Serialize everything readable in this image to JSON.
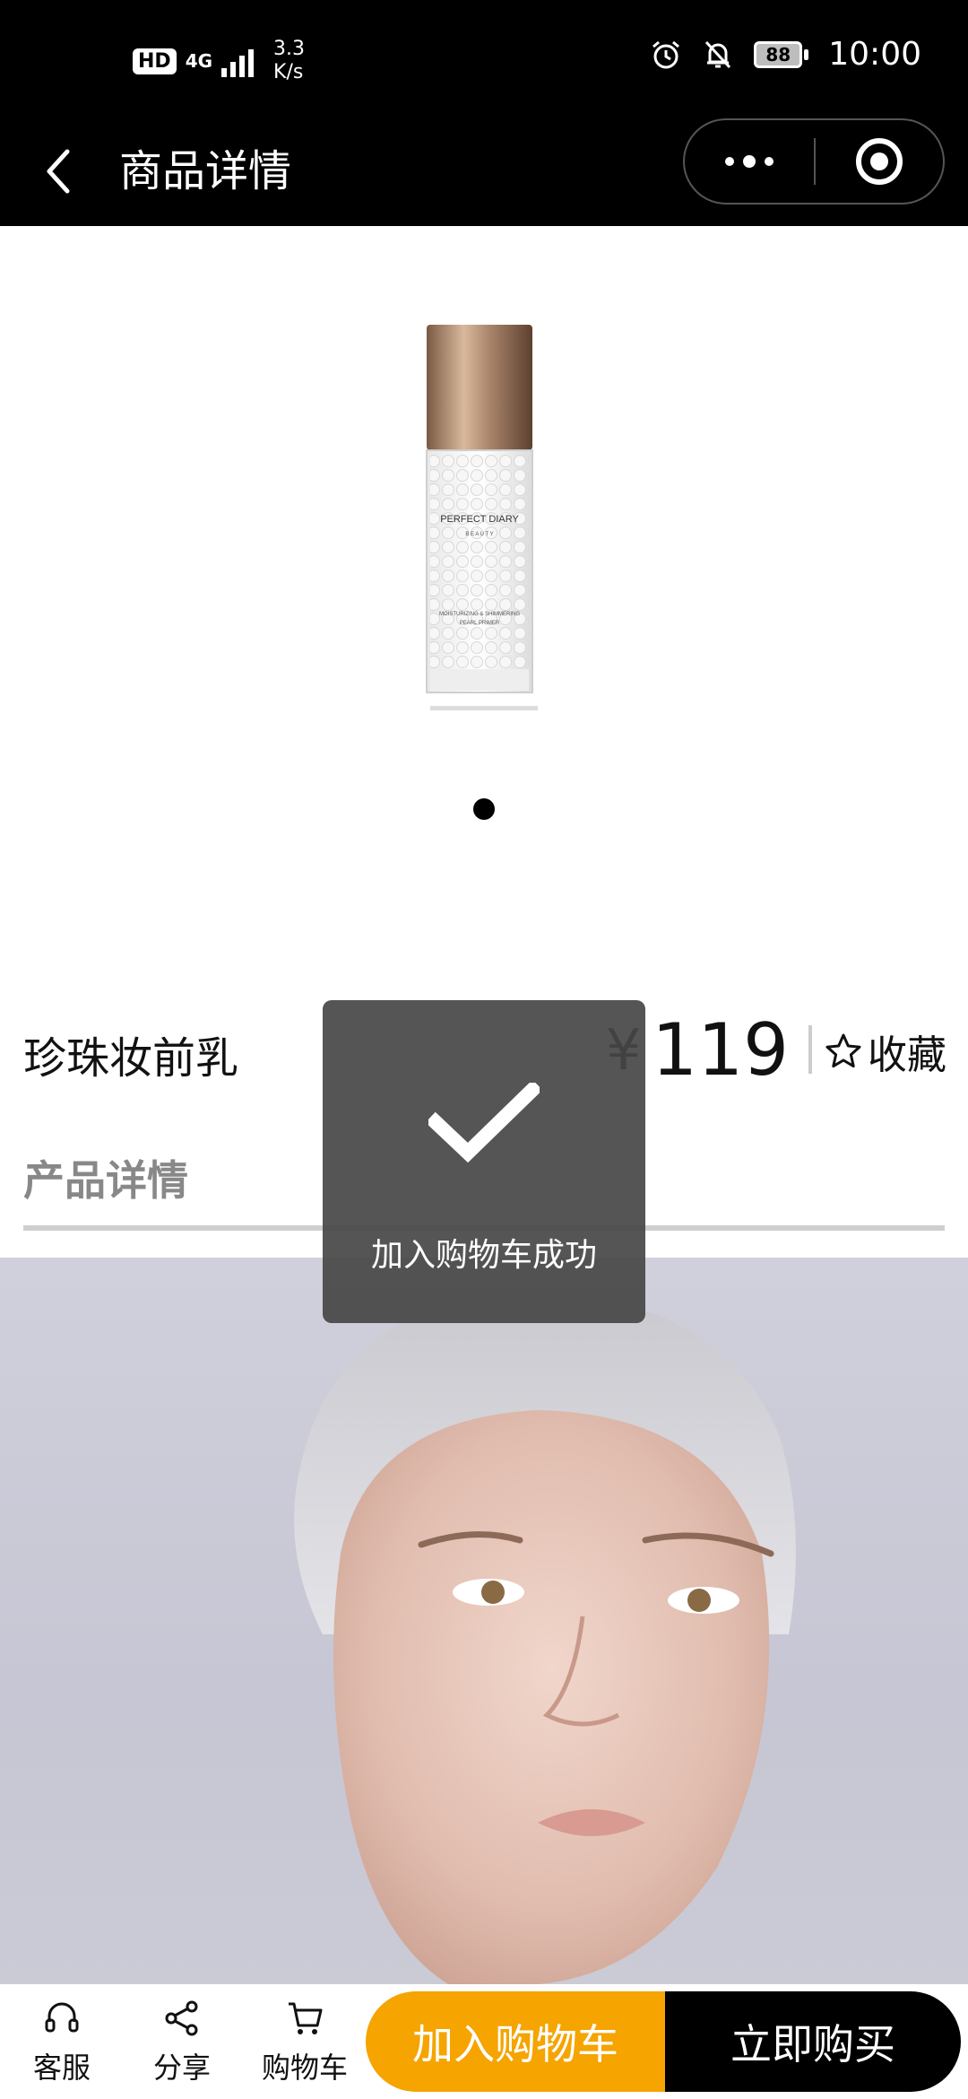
{
  "status_bar": {
    "hd": "HD",
    "network": "4G",
    "speed_value": "3.3",
    "speed_unit": "K/s",
    "battery": "88",
    "time": "10:00"
  },
  "nav": {
    "title": "商品详情"
  },
  "product": {
    "brand": "PERFECT DIARY",
    "brand_sub": "B E A U T Y",
    "label_line1": "MOISTURIZING & SHIMMERING",
    "label_line2": "PEARL PRIMER",
    "name": "珍珠妆前乳",
    "currency": "¥",
    "price": "119",
    "favorite_label": "收藏"
  },
  "section": {
    "title": "产品详情"
  },
  "toast": {
    "message": "加入购物车成功"
  },
  "bottom": {
    "service_label": "客服",
    "share_label": "分享",
    "cart_label": "购物车",
    "add_to_cart": "加入购物车",
    "buy_now": "立即购买"
  },
  "colors": {
    "accent": "#f5a400",
    "dark": "#000000",
    "toast_bg": "#464646"
  }
}
